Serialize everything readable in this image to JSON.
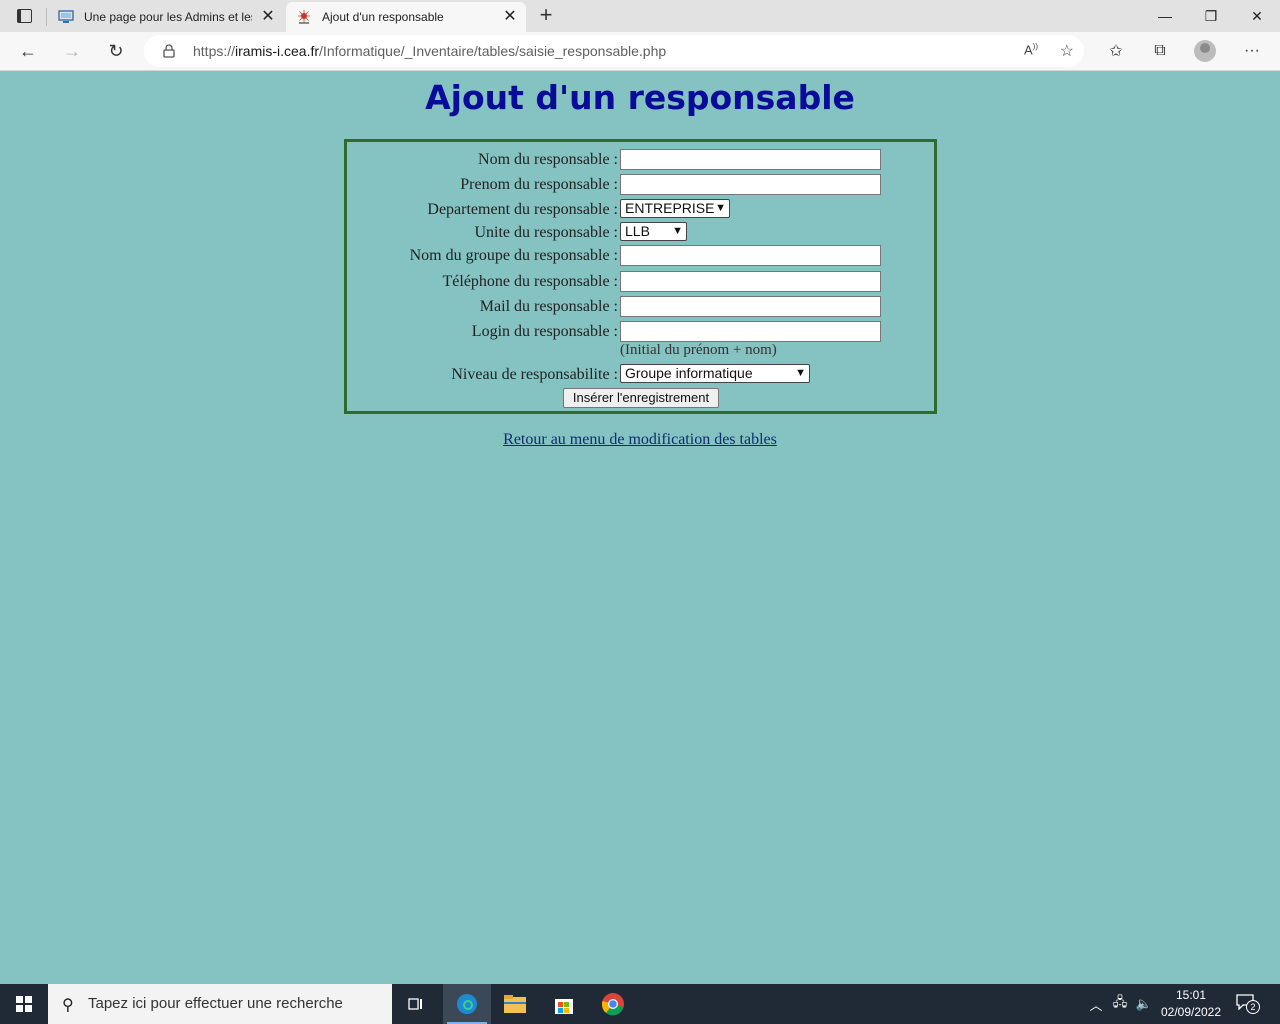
{
  "browser": {
    "tabs": [
      {
        "title": "Une page pour les Admins et les",
        "active": false,
        "icon": "monitor-icon"
      },
      {
        "title": "Ajout d'un responsable",
        "active": true,
        "icon": "cea-logo-icon"
      }
    ],
    "url_scheme": "https://",
    "url_host": "iramis-i.cea.fr",
    "url_path": "/Informatique/_Inventaire/tables/saisie_responsable.php"
  },
  "page": {
    "title": "Ajout d'un responsable",
    "form": {
      "nom_label": "Nom du responsable :",
      "nom_value": "",
      "prenom_label": "Prenom du responsable :",
      "prenom_value": "",
      "departement_label": "Departement du responsable :",
      "departement_value": "ENTREPRISE",
      "unite_label": "Unite du responsable :",
      "unite_value": "LLB",
      "groupe_label": "Nom du groupe du responsable :",
      "groupe_value": "",
      "telephone_label": "Téléphone du responsable :",
      "telephone_value": "",
      "mail_label": "Mail du responsable :",
      "mail_value": "",
      "login_label": "Login du responsable :",
      "login_value": "",
      "login_hint": "(Initial du prénom + nom)",
      "niveau_label": "Niveau de responsabilite :",
      "niveau_value": "Groupe informatique",
      "submit_label": "Insérer l'enregistrement"
    },
    "back_link": "Retour au menu de modification des tables"
  },
  "taskbar": {
    "search_placeholder": "Tapez ici pour effectuer une recherche",
    "time": "15:01",
    "date": "02/09/2022",
    "notification_count": "2"
  }
}
